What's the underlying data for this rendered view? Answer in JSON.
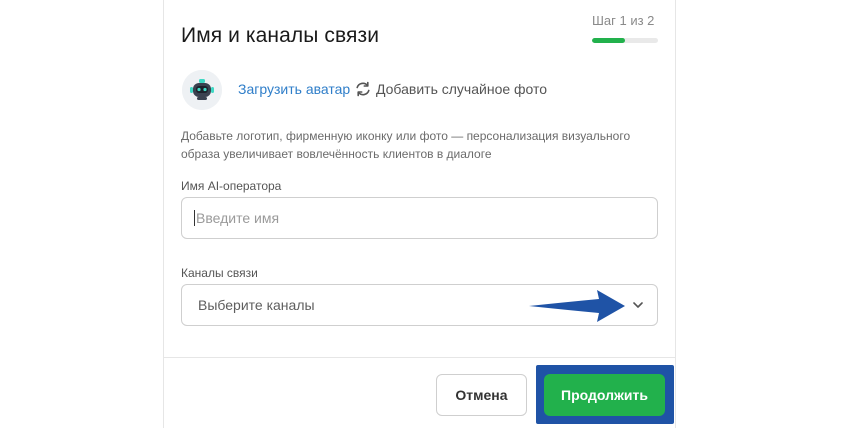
{
  "dialog": {
    "title": "Имя и каналы связи",
    "step_label": "Шаг 1 из 2",
    "step_progress": 0.5
  },
  "avatar": {
    "icon": "robot-avatar-icon",
    "upload_label": "Загрузить аватар",
    "random_label": "Добавить случайное фото",
    "random_icon": "refresh-icon",
    "hint": "Добавьте логотип, фирменную иконку или фото — персонализация визуального образа увеличивает вовлечённость клиентов в диалоге"
  },
  "operator_name": {
    "label": "Имя AI-оператора",
    "placeholder": "Введите имя",
    "value": ""
  },
  "channels": {
    "label": "Каналы связи",
    "placeholder": "Выберите каналы",
    "icon": "chevron-down-icon"
  },
  "footer": {
    "cancel_label": "Отмена",
    "continue_label": "Продолжить"
  },
  "colors": {
    "accent": "#22b14c",
    "link": "#2f7ec9",
    "annotation": "#1f53a6"
  }
}
